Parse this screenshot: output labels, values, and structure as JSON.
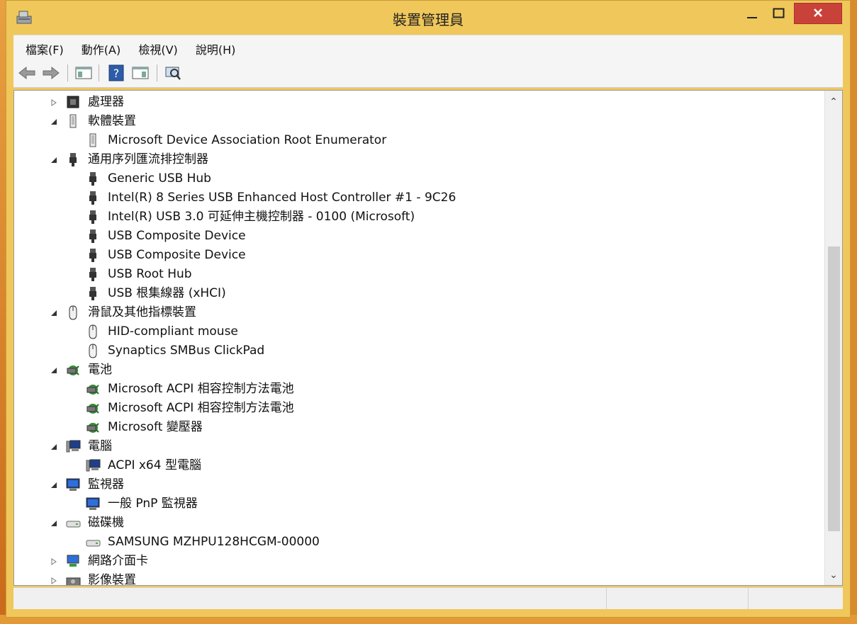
{
  "window": {
    "title": "裝置管理員",
    "minimize_glyph": "—",
    "maximize_glyph": "☐",
    "close_glyph": "✕"
  },
  "menu": [
    {
      "label": "檔案(F)"
    },
    {
      "label": "動作(A)"
    },
    {
      "label": "檢視(V)"
    },
    {
      "label": "說明(H)"
    }
  ],
  "toolbar": {
    "icons": [
      "back-arrow-icon",
      "forward-arrow-icon",
      "show-hide-console-tree-icon",
      "help-icon",
      "properties-pane-icon",
      "scan-hardware-icon"
    ]
  },
  "tree": [
    {
      "level": 0,
      "expander": "collapsed",
      "icon": "processor-icon",
      "label": "處理器"
    },
    {
      "level": 0,
      "expander": "expanded",
      "icon": "software-device-icon",
      "label": "軟體裝置"
    },
    {
      "level": 1,
      "expander": "none",
      "icon": "software-device-icon",
      "label": "Microsoft Device Association Root Enumerator"
    },
    {
      "level": 0,
      "expander": "expanded",
      "icon": "usb-icon",
      "label": "通用序列匯流排控制器"
    },
    {
      "level": 1,
      "expander": "none",
      "icon": "usb-icon",
      "label": "Generic USB Hub"
    },
    {
      "level": 1,
      "expander": "none",
      "icon": "usb-icon",
      "label": "Intel(R) 8 Series USB Enhanced Host Controller #1 - 9C26"
    },
    {
      "level": 1,
      "expander": "none",
      "icon": "usb-icon",
      "label": "Intel(R) USB 3.0 可延伸主機控制器 - 0100 (Microsoft)"
    },
    {
      "level": 1,
      "expander": "none",
      "icon": "usb-icon",
      "label": "USB Composite Device"
    },
    {
      "level": 1,
      "expander": "none",
      "icon": "usb-icon",
      "label": "USB Composite Device"
    },
    {
      "level": 1,
      "expander": "none",
      "icon": "usb-icon",
      "label": "USB Root Hub"
    },
    {
      "level": 1,
      "expander": "none",
      "icon": "usb-icon",
      "label": "USB 根集線器 (xHCI)"
    },
    {
      "level": 0,
      "expander": "expanded",
      "icon": "mouse-icon",
      "label": "滑鼠及其他指標裝置"
    },
    {
      "level": 1,
      "expander": "none",
      "icon": "mouse-icon",
      "label": "HID-compliant mouse"
    },
    {
      "level": 1,
      "expander": "none",
      "icon": "mouse-icon",
      "label": "Synaptics SMBus ClickPad"
    },
    {
      "level": 0,
      "expander": "expanded",
      "icon": "battery-icon",
      "label": "電池"
    },
    {
      "level": 1,
      "expander": "none",
      "icon": "battery-icon",
      "label": "Microsoft ACPI 相容控制方法電池"
    },
    {
      "level": 1,
      "expander": "none",
      "icon": "battery-icon",
      "label": "Microsoft ACPI 相容控制方法電池"
    },
    {
      "level": 1,
      "expander": "none",
      "icon": "battery-icon",
      "label": "Microsoft 變壓器"
    },
    {
      "level": 0,
      "expander": "expanded",
      "icon": "computer-icon",
      "label": "電腦"
    },
    {
      "level": 1,
      "expander": "none",
      "icon": "computer-icon",
      "label": "ACPI x64 型電腦"
    },
    {
      "level": 0,
      "expander": "expanded",
      "icon": "monitor-icon",
      "label": "監視器"
    },
    {
      "level": 1,
      "expander": "none",
      "icon": "monitor-icon",
      "label": "一般 PnP 監視器"
    },
    {
      "level": 0,
      "expander": "expanded",
      "icon": "disk-drive-icon",
      "label": "磁碟機"
    },
    {
      "level": 1,
      "expander": "none",
      "icon": "disk-drive-icon",
      "label": "SAMSUNG MZHPU128HCGM-00000"
    },
    {
      "level": 0,
      "expander": "collapsed",
      "icon": "network-adapter-icon",
      "label": "網路介面卡"
    },
    {
      "level": 0,
      "expander": "collapsed",
      "icon": "imaging-device-icon",
      "label": "影像裝置"
    }
  ],
  "scrollbar": {
    "up_glyph": "⌃",
    "down_glyph": "⌄"
  },
  "colors": {
    "titlebar": "#f0c75a",
    "close_button": "#c9423a",
    "selection": "#ffffff"
  }
}
